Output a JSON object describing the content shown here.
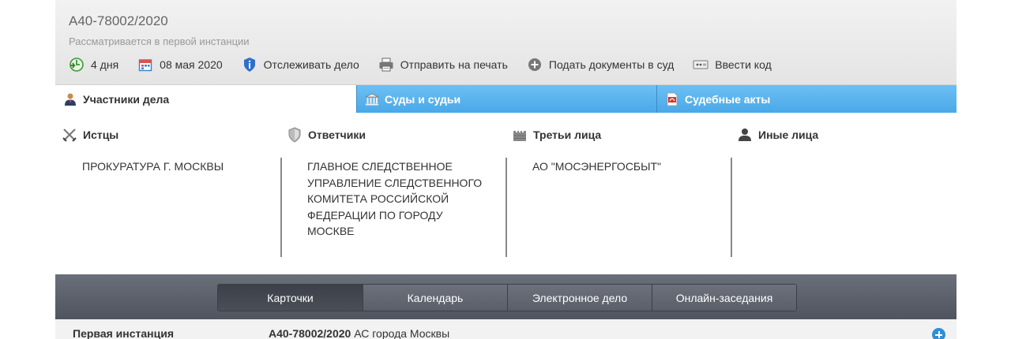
{
  "header": {
    "case_number": "А40-78002/2020",
    "status": "Рассматривается в первой инстанции"
  },
  "toolbar": {
    "items": [
      {
        "icon": "days-icon",
        "label": "4 дня"
      },
      {
        "icon": "calendar-icon",
        "label": "08 мая 2020"
      },
      {
        "icon": "info-shield-icon",
        "label": "Отслеживать дело"
      },
      {
        "icon": "printer-icon",
        "label": "Отправить на печать"
      },
      {
        "icon": "plus-circle-icon",
        "label": "Подать документы в суд"
      },
      {
        "icon": "code-icon",
        "label": "Ввести код"
      }
    ]
  },
  "tabs": [
    {
      "icon": "person-icon",
      "label": "Участники дела"
    },
    {
      "icon": "court-building-icon",
      "label": "Суды и судьи"
    },
    {
      "icon": "pdf-document-icon",
      "label": "Судебные акты"
    }
  ],
  "participants": [
    {
      "icon": "swords-icon",
      "title": "Истцы",
      "text": "ПРОКУРАТУРА Г. МОСКВЫ"
    },
    {
      "icon": "shield-icon",
      "title": "Ответчики",
      "text": "ГЛАВНОЕ СЛЕДСТВЕННОЕ УПРАВЛЕНИЕ СЛЕДСТВЕННОГО КОМИТЕТА РОССИЙСКОЙ ФЕДЕРАЦИИ ПО ГОРОДУ МОСКВЕ"
    },
    {
      "icon": "castle-wall-icon",
      "title": "Третьи лица",
      "text": "АО \"МОСЭНЕРГОСБЫТ\""
    },
    {
      "icon": "user-silhouette-icon",
      "title": "Иные лица",
      "text": ""
    }
  ],
  "nav": {
    "buttons": [
      "Карточки",
      "Календарь",
      "Электронное дело",
      "Онлайн-заседания"
    ],
    "active_index": 0
  },
  "instance": {
    "label": "Первая инстанция",
    "case_number": "А40-78002/2020",
    "court": "АС города Москвы"
  },
  "colors": {
    "tab_blue": "#4aa8e8",
    "nav_bg": "#5a5f69",
    "plus_blue": "#2f8ed8"
  }
}
